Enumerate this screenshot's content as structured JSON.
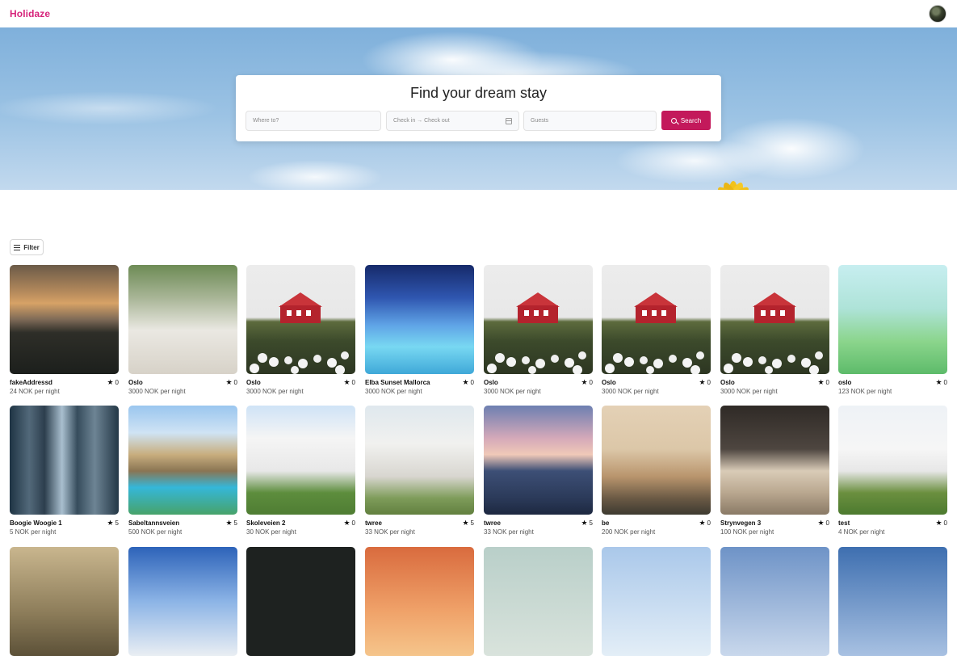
{
  "header": {
    "logo": "Holidaze",
    "avatar_icon": "user-avatar"
  },
  "hero": {
    "title": "Find your dream stay",
    "where_placeholder": "Where to?",
    "dates_placeholder": "Check in → Check out",
    "guests_placeholder": "Guests",
    "search_label": "Search",
    "accent_color": "#c3195b"
  },
  "filter": {
    "label": "Filter"
  },
  "venues": [
    {
      "name": "fakeAddressd",
      "rating": "0",
      "price": "24 NOK per night",
      "image": "sunset-silhouette"
    },
    {
      "name": "Oslo",
      "rating": "0",
      "price": "3000 NOK per night",
      "image": "garden-shed"
    },
    {
      "name": "Oslo",
      "rating": "0",
      "price": "3000 NOK per night",
      "image": "red-house-field"
    },
    {
      "name": "Elba Sunset Mallorca",
      "rating": "0",
      "price": "3000 NOK per night",
      "image": "hotel-pool-night"
    },
    {
      "name": "Oslo",
      "rating": "0",
      "price": "3000 NOK per night",
      "image": "red-house-field"
    },
    {
      "name": "Oslo",
      "rating": "0",
      "price": "3000 NOK per night",
      "image": "red-house-field"
    },
    {
      "name": "Oslo",
      "rating": "0",
      "price": "3000 NOK per night",
      "image": "red-house-field"
    },
    {
      "name": "oslo",
      "rating": "0",
      "price": "123 NOK per night",
      "image": "illustration-girl-cat"
    },
    {
      "name": "Boogie Woogie 1",
      "rating": "5",
      "price": "5 NOK per night",
      "image": "city-skyscrapers"
    },
    {
      "name": "Sabeltannsveien",
      "rating": "5",
      "price": "500 NOK per night",
      "image": "villa-pool"
    },
    {
      "name": "Skoleveien 2",
      "rating": "0",
      "price": "30 NOK per night",
      "image": "modern-white-house"
    },
    {
      "name": "twree",
      "rating": "5",
      "price": "33 NOK per night",
      "image": "white-cottage"
    },
    {
      "name": "twree",
      "rating": "5",
      "price": "33 NOK per night",
      "image": "house-dusk"
    },
    {
      "name": "be",
      "rating": "0",
      "price": "200 NOK per night",
      "image": "church-man"
    },
    {
      "name": "Strynvegen 3",
      "rating": "0",
      "price": "100 NOK per night",
      "image": "hotel-bedroom"
    },
    {
      "name": "test",
      "rating": "0",
      "price": "4 NOK per night",
      "image": "white-farmhouse"
    },
    {
      "image": "tiger"
    },
    {
      "image": "white-roof"
    },
    {
      "image": "dark"
    },
    {
      "image": "orange-sky"
    },
    {
      "image": "tree-church"
    },
    {
      "image": "light-sky-house"
    },
    {
      "image": "blue-sky-house"
    },
    {
      "image": "blue-sky-building"
    }
  ]
}
